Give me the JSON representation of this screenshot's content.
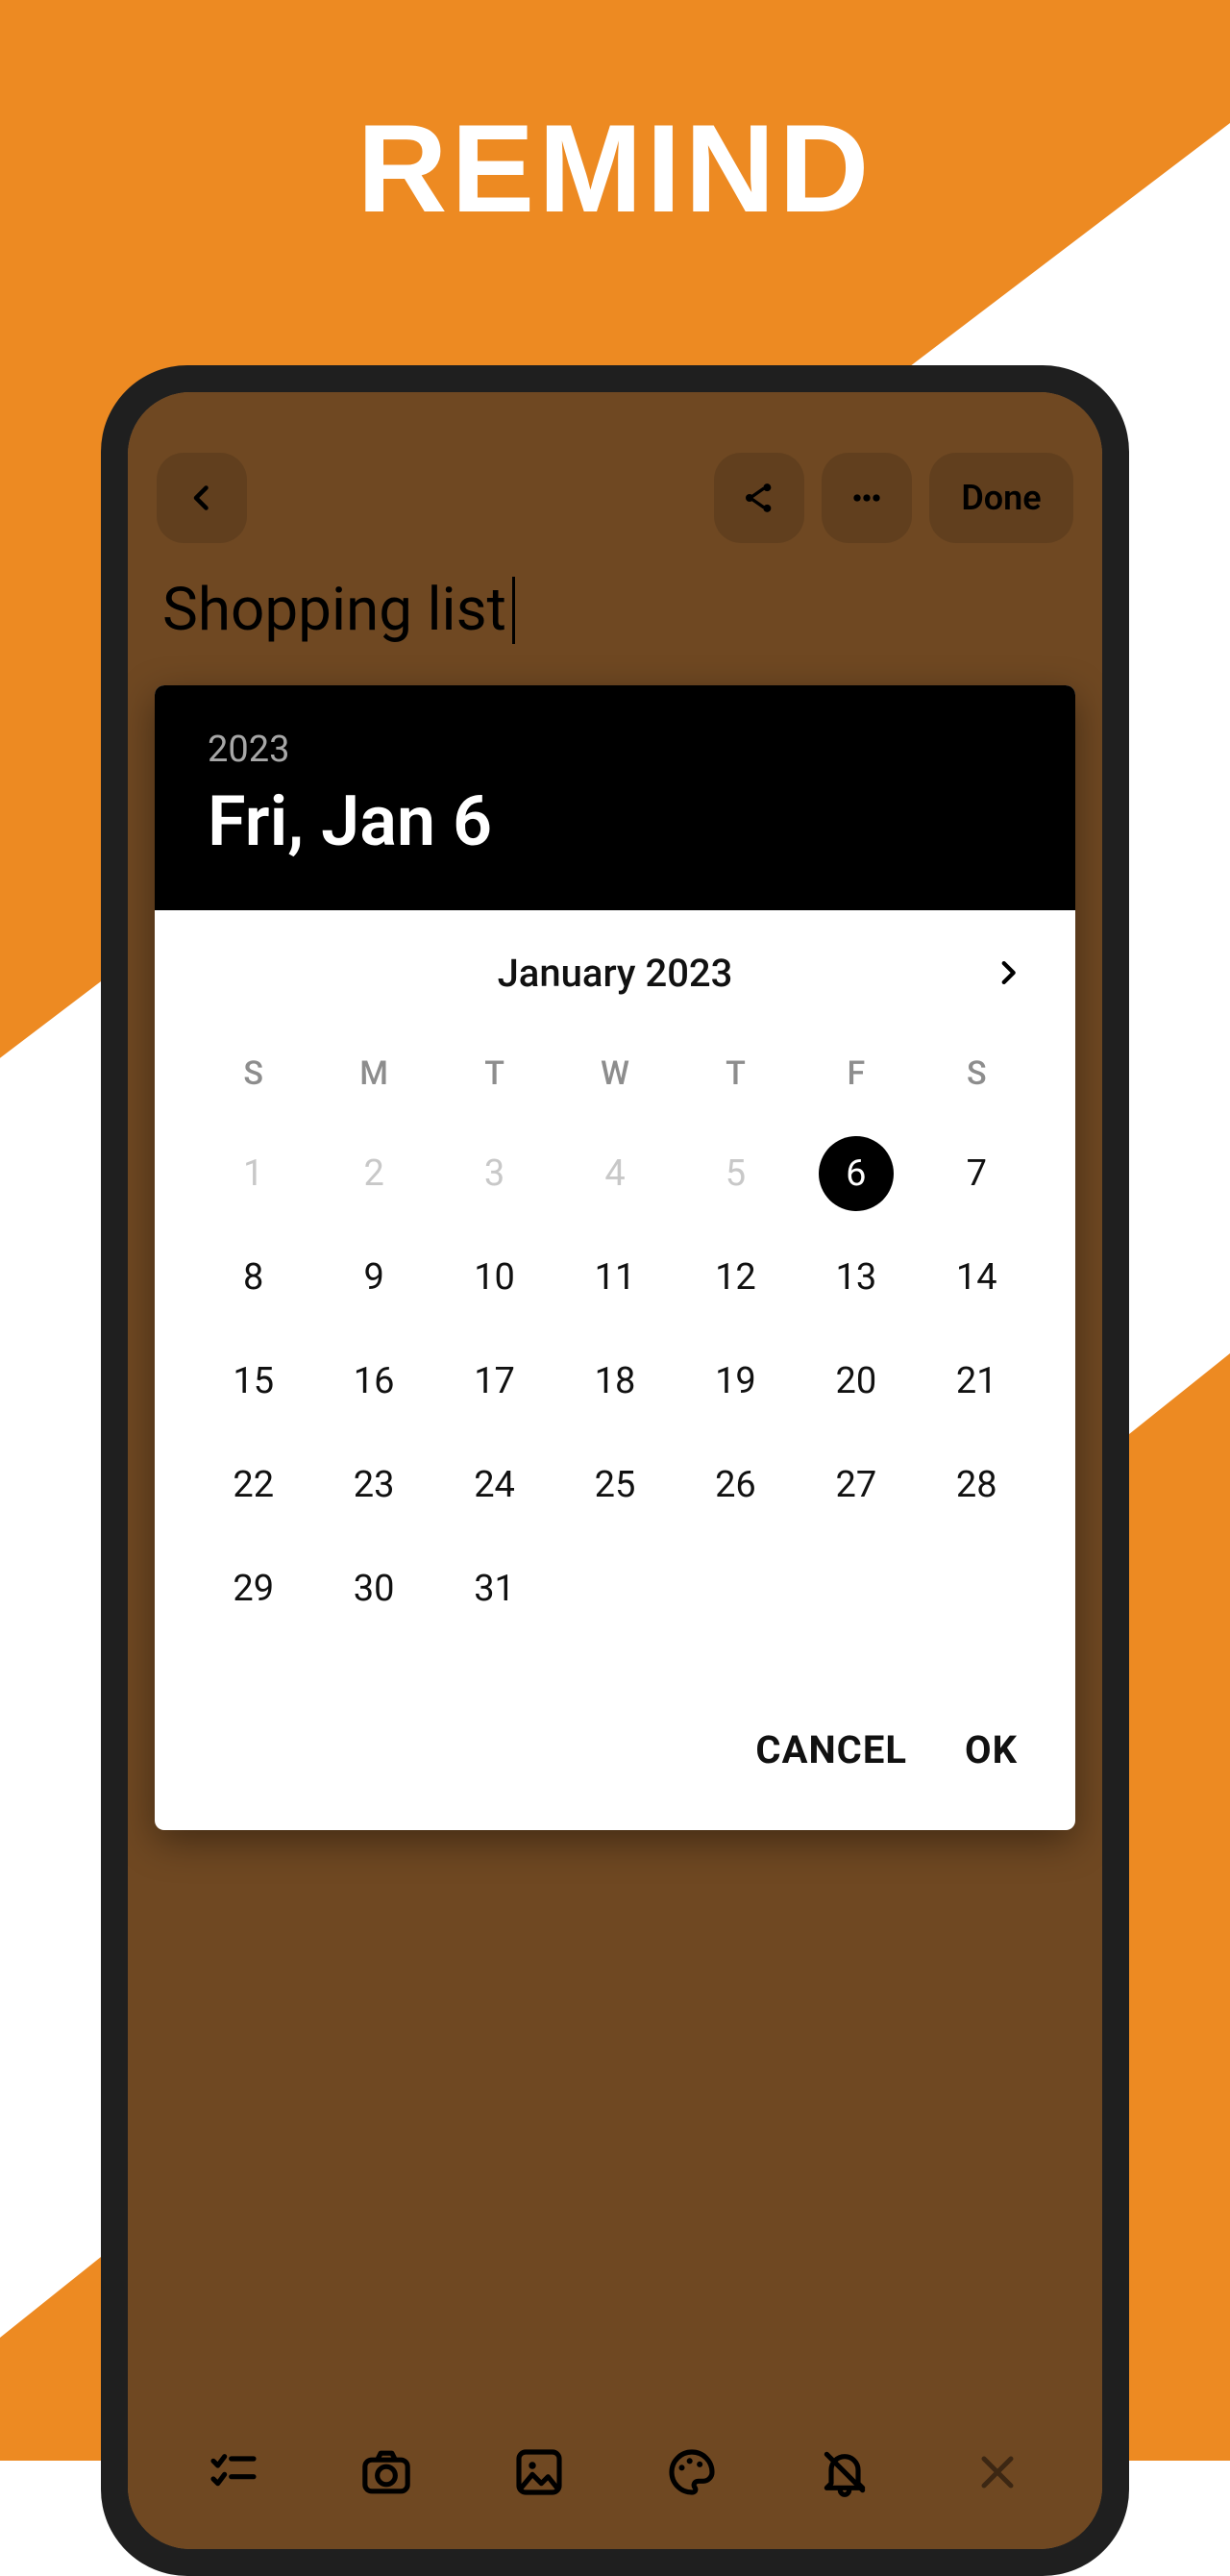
{
  "banner": {
    "title": "REMIND"
  },
  "topbar": {
    "back_icon": "back-icon",
    "share_icon": "share-icon",
    "more_icon": "more-icon",
    "done_label": "Done"
  },
  "note": {
    "title": "Shopping list"
  },
  "datepicker": {
    "year": "2023",
    "full_date": "Fri, Jan 6",
    "month_label": "January 2023",
    "dow": [
      "S",
      "M",
      "T",
      "W",
      "T",
      "F",
      "S"
    ],
    "weeks": [
      [
        {
          "n": "1",
          "muted": true
        },
        {
          "n": "2",
          "muted": true
        },
        {
          "n": "3",
          "muted": true
        },
        {
          "n": "4",
          "muted": true
        },
        {
          "n": "5",
          "muted": true
        },
        {
          "n": "6",
          "selected": true
        },
        {
          "n": "7"
        }
      ],
      [
        {
          "n": "8"
        },
        {
          "n": "9"
        },
        {
          "n": "10"
        },
        {
          "n": "11"
        },
        {
          "n": "12"
        },
        {
          "n": "13"
        },
        {
          "n": "14"
        }
      ],
      [
        {
          "n": "15"
        },
        {
          "n": "16"
        },
        {
          "n": "17"
        },
        {
          "n": "18"
        },
        {
          "n": "19"
        },
        {
          "n": "20"
        },
        {
          "n": "21"
        }
      ],
      [
        {
          "n": "22"
        },
        {
          "n": "23"
        },
        {
          "n": "24"
        },
        {
          "n": "25"
        },
        {
          "n": "26"
        },
        {
          "n": "27"
        },
        {
          "n": "28"
        }
      ],
      [
        {
          "n": "29"
        },
        {
          "n": "30"
        },
        {
          "n": "31"
        },
        {
          "n": ""
        },
        {
          "n": ""
        },
        {
          "n": ""
        },
        {
          "n": ""
        }
      ]
    ],
    "cancel_label": "CANCEL",
    "ok_label": "OK"
  },
  "bottombar": {
    "icons": [
      "checklist-icon",
      "camera-icon",
      "image-icon",
      "palette-icon",
      "bell-icon",
      "close-icon"
    ]
  }
}
